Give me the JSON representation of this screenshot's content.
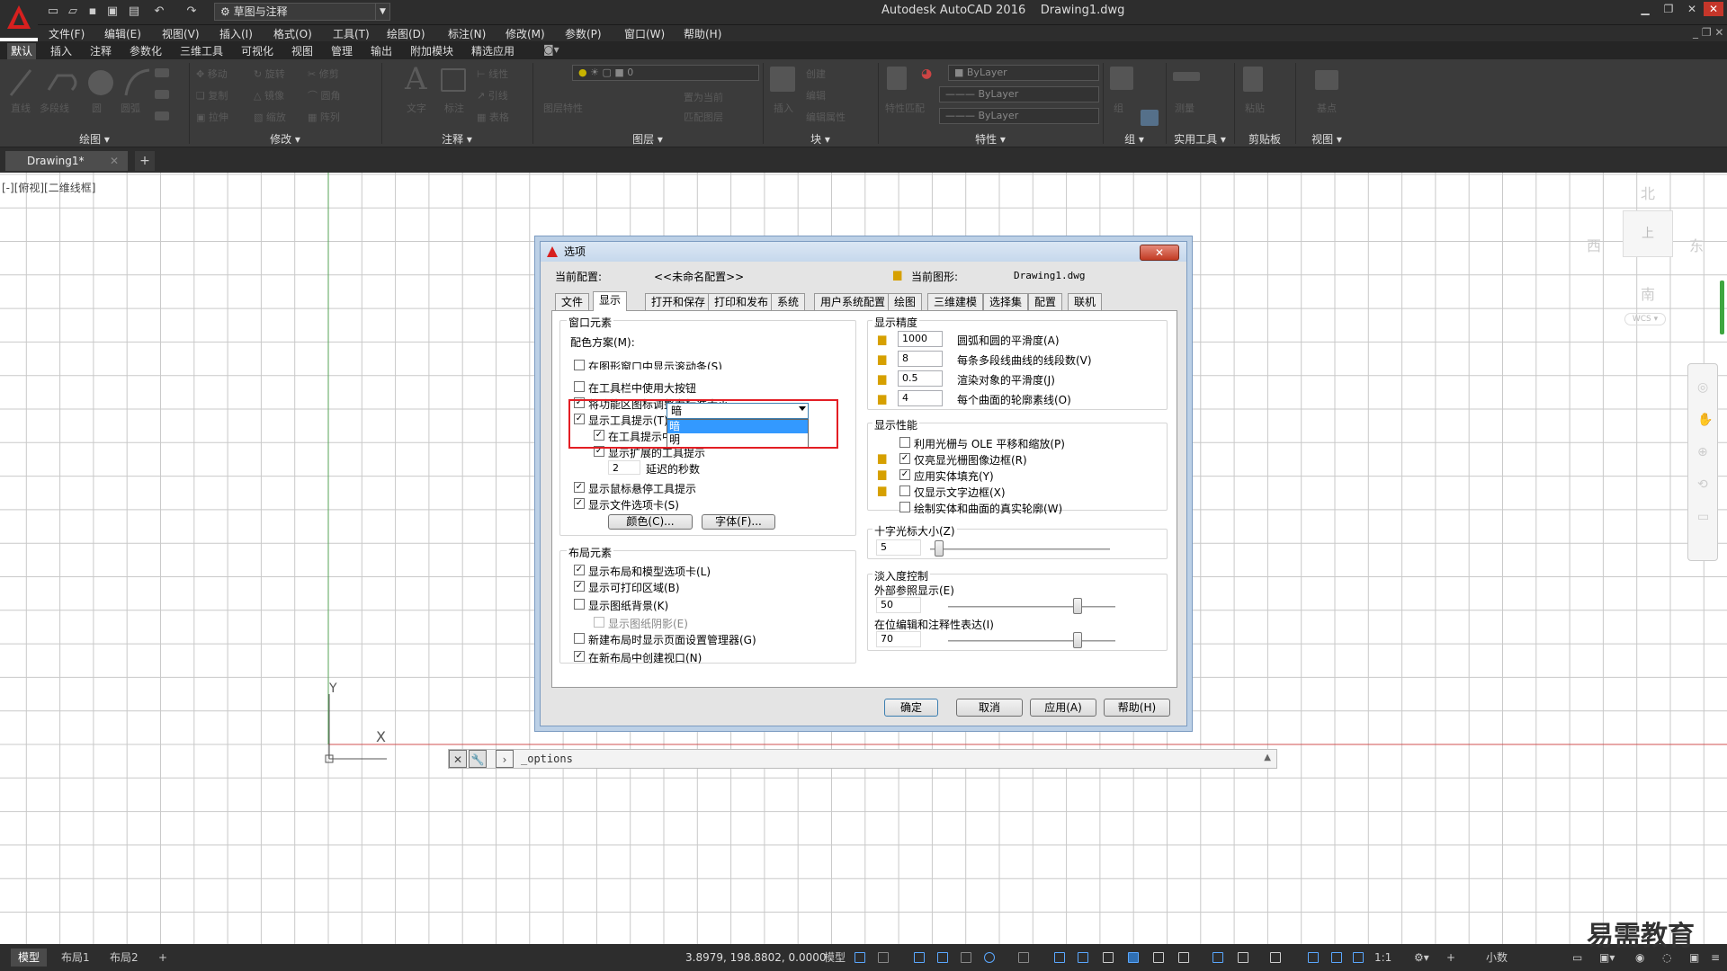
{
  "app": {
    "title": "Autodesk AutoCAD 2016",
    "document": "Drawing1.dwg",
    "workspace": "草图与注释"
  },
  "menu": [
    "文件(F)",
    "编辑(E)",
    "视图(V)",
    "插入(I)",
    "格式(O)",
    "工具(T)",
    "绘图(D)",
    "标注(N)",
    "修改(M)",
    "参数(P)",
    "窗口(W)",
    "帮助(H)"
  ],
  "ribbon_tabs": [
    "默认",
    "插入",
    "注释",
    "参数化",
    "三维工具",
    "可视化",
    "视图",
    "管理",
    "输出",
    "附加模块",
    "精选应用"
  ],
  "ribbon_panels": [
    "绘图",
    "修改",
    "注释",
    "图层",
    "块",
    "特性",
    "组",
    "实用工具",
    "剪贴板",
    "视图"
  ],
  "ribbon": {
    "draw_tools": [
      "直线",
      "多段线",
      "圆",
      "圆弧"
    ],
    "modify_tools": [
      "移动",
      "旋转",
      "修剪",
      "复制",
      "镜像",
      "圆角",
      "拉伸",
      "缩放",
      "阵列"
    ],
    "annot_tools": [
      "文字",
      "标注",
      "线性",
      "引线",
      "表格"
    ],
    "layer_value": "0",
    "layer_tools": [
      "图层特性",
      "置为当前",
      "匹配图层"
    ],
    "block_tools": [
      "插入",
      "创建",
      "编辑",
      "编辑属性"
    ],
    "prop_bylayer": [
      "ByLayer",
      "ByLayer",
      "ByLayer"
    ],
    "prop_tools": [
      "特性匹配"
    ],
    "group_tools": [
      "组"
    ],
    "util_tools": [
      "测量"
    ],
    "clip_tools": [
      "粘贴"
    ],
    "view_tools": [
      "基点"
    ]
  },
  "doc_tab": "Drawing1*",
  "viewport_label": "[-][俯视][二维线框]",
  "viewcube": {
    "north": "北",
    "south": "南",
    "east": "东",
    "west": "西",
    "top": "上",
    "wcs": "WCS"
  },
  "axis": {
    "x": "X",
    "y": "Y"
  },
  "command_line": "_options",
  "layout_tabs": [
    "模型",
    "布局1",
    "布局2"
  ],
  "status": {
    "coords": "3.8979, 198.8802, 0.0000",
    "model": "模型",
    "scale": "1:1",
    "units": "小数"
  },
  "watermark": "易需教育",
  "dialog": {
    "title": "选项",
    "profile_label": "当前配置:",
    "profile_value": "<<未命名配置>>",
    "drawing_label": "当前图形:",
    "drawing_value": "Drawing1.dwg",
    "tabs": [
      "文件",
      "显示",
      "打开和保存",
      "打印和发布",
      "系统",
      "用户系统配置",
      "绘图",
      "三维建模",
      "选择集",
      "配置",
      "联机"
    ],
    "window_elements": {
      "title": "窗口元素",
      "scheme_label": "配色方案(M):",
      "scheme_value": "暗",
      "scheme_options": [
        "暗",
        "明"
      ],
      "checkboxes": [
        {
          "label": "在图形窗口中显示滚动条(S)",
          "checked": false
        },
        {
          "label": "在工具栏中使用大按钮",
          "checked": false
        },
        {
          "label": "将功能区图标调整为标准大小",
          "checked": true
        },
        {
          "label": "显示工具提示(T)",
          "checked": true
        },
        {
          "label": "在工具提示中显示快捷键",
          "checked": true
        },
        {
          "label": "显示扩展的工具提示",
          "checked": true
        },
        {
          "label": "显示鼠标悬停工具提示",
          "checked": true
        },
        {
          "label": "显示文件选项卡(S)",
          "checked": true
        }
      ],
      "delay_value": "2",
      "delay_label": "延迟的秒数",
      "colors_btn": "颜色(C)...",
      "fonts_btn": "字体(F)..."
    },
    "layout_elements": {
      "title": "布局元素",
      "checkboxes": [
        {
          "label": "显示布局和模型选项卡(L)",
          "checked": true
        },
        {
          "label": "显示可打印区域(B)",
          "checked": true
        },
        {
          "label": "显示图纸背景(K)",
          "checked": false
        },
        {
          "label": "显示图纸阴影(E)",
          "checked": false
        },
        {
          "label": "新建布局时显示页面设置管理器(G)",
          "checked": false
        },
        {
          "label": "在新布局中创建视口(N)",
          "checked": true
        }
      ]
    },
    "resolution": {
      "title": "显示精度",
      "rows": [
        {
          "value": "1000",
          "label": "圆弧和圆的平滑度(A)"
        },
        {
          "value": "8",
          "label": "每条多段线曲线的线段数(V)"
        },
        {
          "value": "0.5",
          "label": "渲染对象的平滑度(J)"
        },
        {
          "value": "4",
          "label": "每个曲面的轮廓素线(O)"
        }
      ]
    },
    "performance": {
      "title": "显示性能",
      "checkboxes": [
        {
          "label": "利用光栅与 OLE 平移和缩放(P)",
          "checked": false
        },
        {
          "label": "仅亮显光栅图像边框(R)",
          "checked": true
        },
        {
          "label": "应用实体填充(Y)",
          "checked": true
        },
        {
          "label": "仅显示文字边框(X)",
          "checked": false
        },
        {
          "label": "绘制实体和曲面的真实轮廓(W)",
          "checked": false
        }
      ]
    },
    "crosshair": {
      "title": "十字光标大小(Z)",
      "value": "5",
      "fraction": 0.05
    },
    "fade": {
      "title": "淡入度控制",
      "xref_label": "外部参照显示(E)",
      "xref_value": "50",
      "xref_fraction": 0.774,
      "inplace_label": "在位编辑和注释性表达(I)",
      "inplace_value": "70",
      "inplace_fraction": 0.774
    },
    "buttons": {
      "ok": "确定",
      "cancel": "取消",
      "apply": "应用(A)",
      "help": "帮助(H)"
    }
  }
}
